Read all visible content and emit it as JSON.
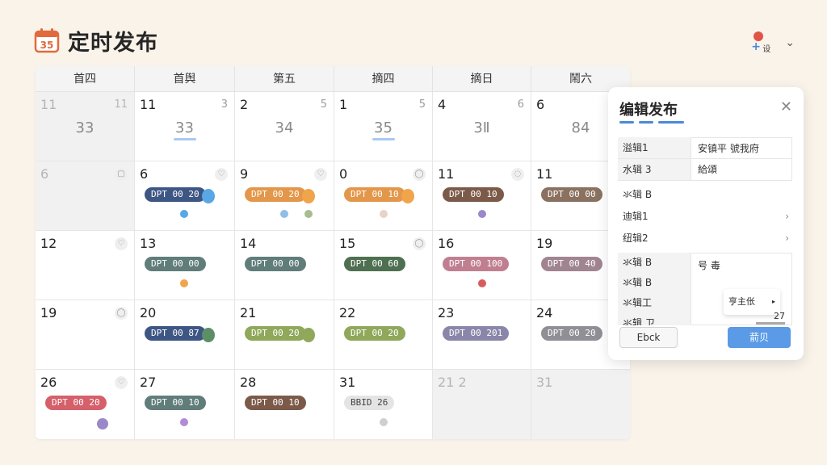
{
  "header": {
    "title": "定时发布",
    "calendar_icon_number": "35",
    "user_label": "设"
  },
  "colors": {
    "accent": "#4a88d8",
    "background": "#faf3ea",
    "tag_navy": "#3e5684",
    "tag_orange": "#e3974a",
    "tag_brown": "#7c5a49",
    "tag_taupe": "#8a7160",
    "tag_slate": "#607d7a",
    "tag_green": "#4f6f51",
    "tag_olive": "#8fa85a",
    "tag_rose": "#c07f91",
    "tag_mauve": "#a08590",
    "tag_lilac": "#8a86a9",
    "tag_red": "#d5606a",
    "tag_grey": "#e4e4e4"
  },
  "weekdays": [
    "首四",
    "首舆",
    "第五",
    "摘四",
    "摘日",
    "鬧六"
  ],
  "weeks": [
    [
      {
        "num": "11",
        "corner": "11",
        "big": "33",
        "muted": true
      },
      {
        "num": "11",
        "corner": "3",
        "big": "33",
        "underline": true
      },
      {
        "num": "2",
        "corner": "5",
        "big": "34"
      },
      {
        "num": "1",
        "corner": "5",
        "big": "35",
        "underline": true
      },
      {
        "num": "4",
        "corner": "6",
        "big": "3Ⅱ"
      },
      {
        "num": "6",
        "big": "84"
      }
    ],
    [
      {
        "num": "6",
        "icon": "▢",
        "muted": true
      },
      {
        "num": "6",
        "icon": "♡",
        "tag": "DPT 00 20",
        "color": "#3e5684",
        "blob": "#5aa7e6",
        "dot": "#5aa7e6"
      },
      {
        "num": "9",
        "icon": "♡",
        "tag": "DPT 00 20",
        "color": "#e3974a",
        "blob": "#f0a54b",
        "dot": "#8fbfe6",
        "dot2": "#a8bd8e"
      },
      {
        "num": "0",
        "icon": "◯",
        "tag": "DPT 00 10",
        "color": "#e3974a",
        "blob": "#f0a54b",
        "dot": "#ead2c7"
      },
      {
        "num": "11",
        "icon": "◌",
        "tag": "DPT 00 10",
        "color": "#7c5a49",
        "dot": "#9b88c9"
      },
      {
        "num": "11",
        "tag": "DPT 00 00",
        "color": "#8a7160"
      }
    ],
    [
      {
        "num": "12",
        "icon": "♡"
      },
      {
        "num": "13",
        "tag": "DPT 00 00",
        "color": "#607d7a",
        "dot": "#f0a54b"
      },
      {
        "num": "14",
        "tag": "DPT 00 00",
        "color": "#607d7a"
      },
      {
        "num": "15",
        "icon": "◯",
        "tag": "DPT 00 60",
        "color": "#4f6f51"
      },
      {
        "num": "16",
        "tag": "DPT 00 100",
        "color": "#c07f91",
        "dot": "#d95c5c"
      },
      {
        "num": "19",
        "tag": "DPT 00 40",
        "color": "#a08590"
      }
    ],
    [
      {
        "num": "19",
        "icon": "◯"
      },
      {
        "num": "20",
        "tag": "DPT 00 87",
        "color": "#3e5684",
        "blob": "#5d8f66"
      },
      {
        "num": "21",
        "tag": "DPT 00 20",
        "color": "#8fa85a",
        "blob": "#8fa85a"
      },
      {
        "num": "22",
        "tag": "DPT 00 20",
        "color": "#8fa85a"
      },
      {
        "num": "23",
        "tag": "DPT 00 201",
        "color": "#8a86a9"
      },
      {
        "num": "24",
        "tag": "DPT 00 20",
        "color": "#8f8f95"
      }
    ],
    [
      {
        "num": "26",
        "icon": "♡",
        "tag": "DPT 00 20",
        "color": "#d5606a",
        "dot": "#9b88c9",
        "dotbig": true
      },
      {
        "num": "27",
        "tag": "DPT 00 10",
        "color": "#607d7a",
        "dot": "#b28ad8"
      },
      {
        "num": "28",
        "tag": "DPT 00 10",
        "color": "#7c5a49"
      },
      {
        "num": "31",
        "tag": "BBID 26",
        "color": "#e4e4e4",
        "darktext": true,
        "dot": "#cfcfcf"
      },
      {
        "num": "21 2",
        "muted": true
      },
      {
        "num": "31",
        "muted": true
      }
    ]
  ],
  "edit_panel": {
    "title": "编辑发布",
    "close": "✕",
    "rows_table": [
      {
        "label": "溢辑1",
        "value": "安镇平   號我府"
      },
      {
        "label": "水辑 3",
        "value": "給頌"
      }
    ],
    "plain_rows": [
      {
        "label": "氺辑 B",
        "arrow": ""
      },
      {
        "label": "迪辑1",
        "arrow": "›"
      },
      {
        "label": "纽辑2",
        "arrow": "›"
      }
    ],
    "block_labels": [
      "氺辑 B",
      "氺辑 B",
      "氺辑工",
      "氺辑 ㄗ"
    ],
    "block_value": "号 毒",
    "popover_text": "亨主伥",
    "popover_caret": "▸",
    "block_number": "27",
    "back_label": "Ebck",
    "ok_label": "葥贝"
  }
}
